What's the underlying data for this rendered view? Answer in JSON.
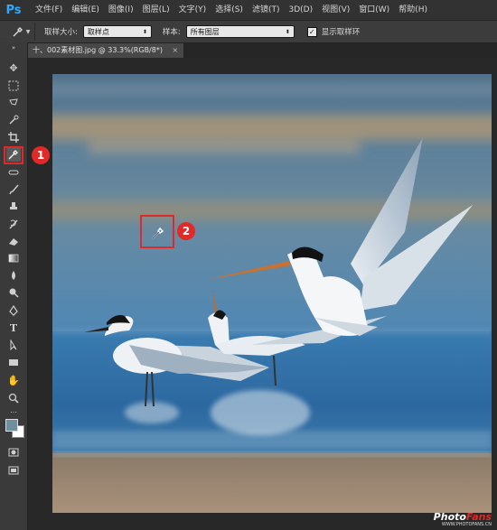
{
  "app": {
    "logo": "Ps"
  },
  "menu": [
    "文件(F)",
    "编辑(E)",
    "图像(I)",
    "图层(L)",
    "文字(Y)",
    "选择(S)",
    "滤镜(T)",
    "3D(D)",
    "视图(V)",
    "窗口(W)",
    "帮助(H)"
  ],
  "options": {
    "tool_icon": "eyedropper-icon",
    "sample_size_label": "取样大小:",
    "sample_size_value": "取样点",
    "sample_label": "样本:",
    "sample_value": "所有图层",
    "show_ring_label": "显示取样环",
    "show_ring_checked": true
  },
  "document": {
    "tab_title": "十、002素材图.jpg @ 33.3%(RGB/8*)",
    "close": "×"
  },
  "annotations": {
    "badge1": "1",
    "badge2": "2"
  },
  "watermark": {
    "main_prefix": "Photo",
    "main_accent": "Fans",
    "sub": "WWW.PHOTOFANS.CN"
  },
  "colors": {
    "highlight": "#e02a2a",
    "ps_blue": "#31a8ff"
  }
}
